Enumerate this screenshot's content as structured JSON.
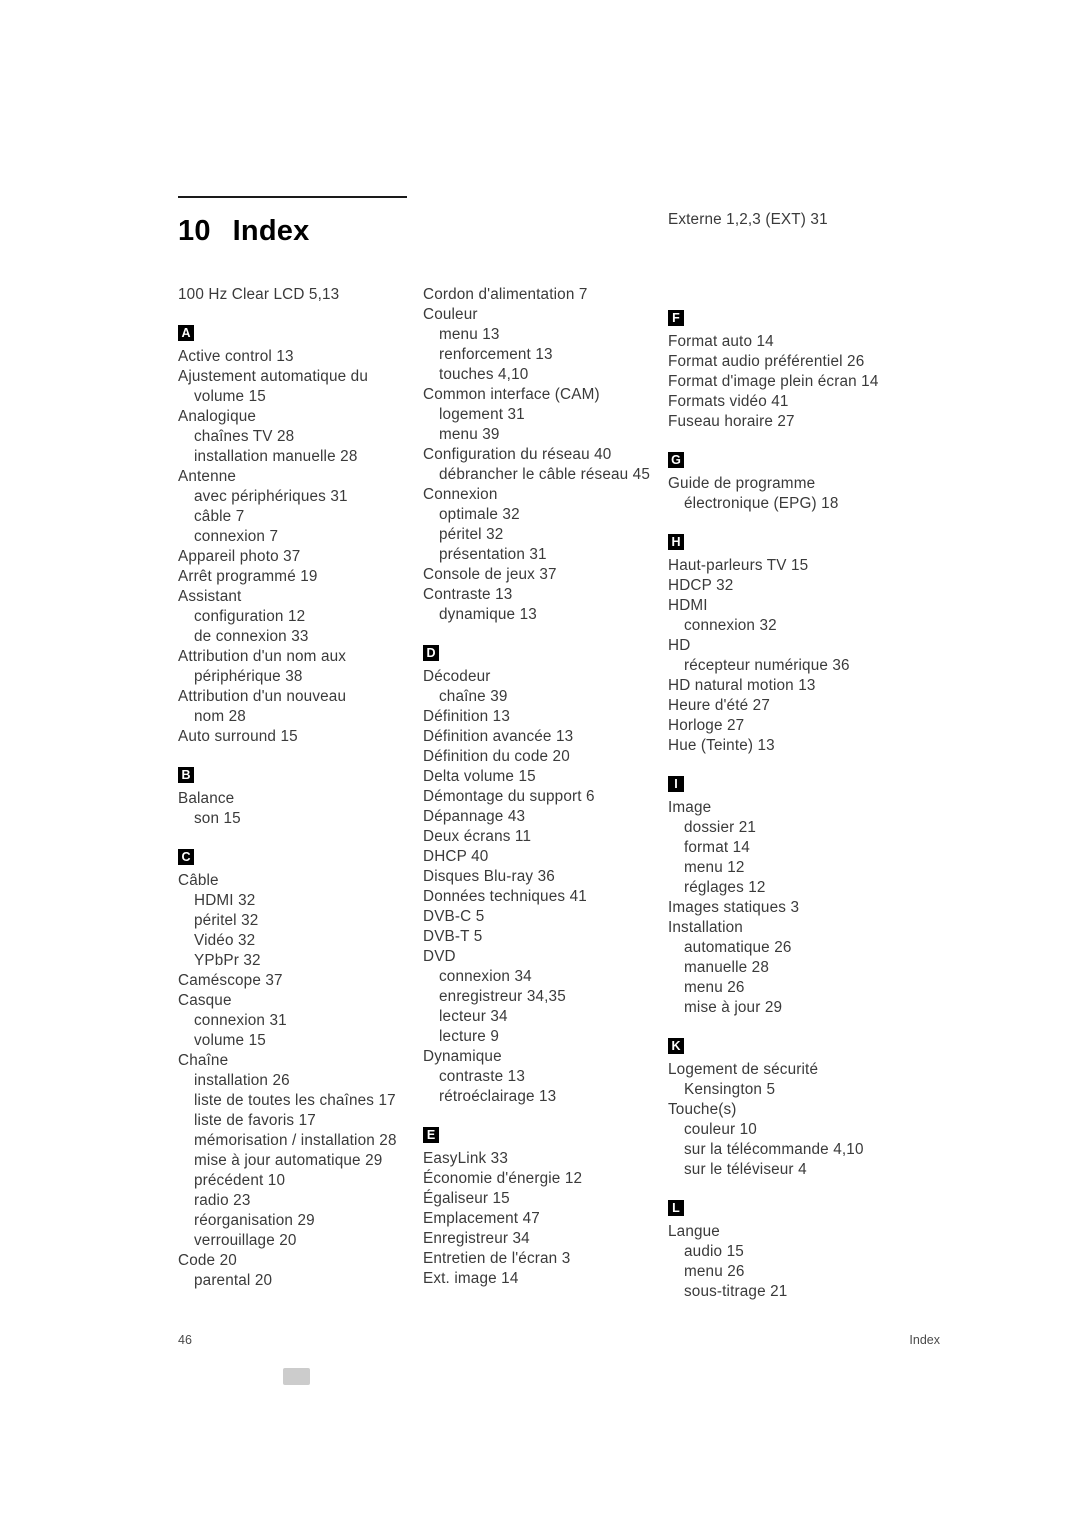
{
  "heading": {
    "number": "10",
    "title": "Index"
  },
  "columns": [
    {
      "id": "column-1",
      "blocks": [
        {
          "type": "entry",
          "level": 0,
          "text": "100 Hz Clear LCD  5,13"
        },
        {
          "type": "letter",
          "letter": "A"
        },
        {
          "type": "entry",
          "level": 0,
          "text": "Active control  13"
        },
        {
          "type": "entry",
          "level": 0,
          "text": "Ajustement automatique du"
        },
        {
          "type": "entry",
          "level": 1,
          "text": "volume  15"
        },
        {
          "type": "entry",
          "level": 0,
          "text": "Analogique"
        },
        {
          "type": "entry",
          "level": 1,
          "text": "chaînes TV  28"
        },
        {
          "type": "entry",
          "level": 1,
          "text": "installation manuelle  28"
        },
        {
          "type": "entry",
          "level": 0,
          "text": "Antenne"
        },
        {
          "type": "entry",
          "level": 1,
          "text": "avec périphériques  31"
        },
        {
          "type": "entry",
          "level": 1,
          "text": "câble  7"
        },
        {
          "type": "entry",
          "level": 1,
          "text": "connexion  7"
        },
        {
          "type": "entry",
          "level": 0,
          "text": "Appareil photo  37"
        },
        {
          "type": "entry",
          "level": 0,
          "text": "Arrêt programmé  19"
        },
        {
          "type": "entry",
          "level": 0,
          "text": "Assistant"
        },
        {
          "type": "entry",
          "level": 1,
          "text": "configuration  12"
        },
        {
          "type": "entry",
          "level": 1,
          "text": "de connexion  33"
        },
        {
          "type": "entry",
          "level": 0,
          "text": "Attribution d'un nom aux"
        },
        {
          "type": "entry",
          "level": 1,
          "text": "périphérique  38"
        },
        {
          "type": "entry",
          "level": 0,
          "text": "Attribution d'un nouveau"
        },
        {
          "type": "entry",
          "level": 1,
          "text": "nom  28"
        },
        {
          "type": "entry",
          "level": 0,
          "text": "Auto surround  15"
        },
        {
          "type": "letter",
          "letter": "B"
        },
        {
          "type": "entry",
          "level": 0,
          "text": "Balance"
        },
        {
          "type": "entry",
          "level": 1,
          "text": "son  15"
        },
        {
          "type": "letter",
          "letter": "C"
        },
        {
          "type": "entry",
          "level": 0,
          "text": "Câble"
        },
        {
          "type": "entry",
          "level": 1,
          "text": "HDMI  32"
        },
        {
          "type": "entry",
          "level": 1,
          "text": "péritel  32"
        },
        {
          "type": "entry",
          "level": 1,
          "text": "Vidéo  32"
        },
        {
          "type": "entry",
          "level": 1,
          "text": "YPbPr  32"
        },
        {
          "type": "entry",
          "level": 0,
          "text": "Caméscope  37"
        },
        {
          "type": "entry",
          "level": 0,
          "text": "Casque"
        },
        {
          "type": "entry",
          "level": 1,
          "text": "connexion  31"
        },
        {
          "type": "entry",
          "level": 1,
          "text": "volume  15"
        },
        {
          "type": "entry",
          "level": 0,
          "text": "Chaîne"
        },
        {
          "type": "entry",
          "level": 1,
          "text": "installation  26"
        },
        {
          "type": "entry",
          "level": 1,
          "text": "liste de toutes les chaînes  17"
        },
        {
          "type": "entry",
          "level": 1,
          "text": "liste de favoris  17"
        },
        {
          "type": "entry",
          "level": 1,
          "text": "mémorisation / installation  28"
        },
        {
          "type": "entry",
          "level": 1,
          "text": "mise à jour automatique  29"
        },
        {
          "type": "entry",
          "level": 1,
          "text": "précédent  10"
        },
        {
          "type": "entry",
          "level": 1,
          "text": "radio  23"
        },
        {
          "type": "entry",
          "level": 1,
          "text": "réorganisation  29"
        },
        {
          "type": "entry",
          "level": 1,
          "text": "verrouillage  20"
        },
        {
          "type": "entry",
          "level": 0,
          "text": "Code  20"
        },
        {
          "type": "entry",
          "level": 1,
          "text": "parental  20"
        }
      ]
    },
    {
      "id": "column-2",
      "blocks": [
        {
          "type": "entry",
          "level": 0,
          "text": "Cordon d'alimentation  7"
        },
        {
          "type": "entry",
          "level": 0,
          "text": "Couleur"
        },
        {
          "type": "entry",
          "level": 1,
          "text": "menu  13"
        },
        {
          "type": "entry",
          "level": 1,
          "text": "renforcement  13"
        },
        {
          "type": "entry",
          "level": 1,
          "text": "touches  4,10"
        },
        {
          "type": "entry",
          "level": 0,
          "text": "Common interface (CAM)"
        },
        {
          "type": "entry",
          "level": 1,
          "text": "logement  31"
        },
        {
          "type": "entry",
          "level": 1,
          "text": "menu  39"
        },
        {
          "type": "entry",
          "level": 0,
          "text": "Configuration du réseau  40"
        },
        {
          "type": "entry",
          "level": 1,
          "text": "débrancher le câble réseau  45"
        },
        {
          "type": "entry",
          "level": 0,
          "text": "Connexion"
        },
        {
          "type": "entry",
          "level": 1,
          "text": "optimale  32"
        },
        {
          "type": "entry",
          "level": 1,
          "text": "péritel  32"
        },
        {
          "type": "entry",
          "level": 1,
          "text": "présentation  31"
        },
        {
          "type": "entry",
          "level": 0,
          "text": "Console de jeux  37"
        },
        {
          "type": "entry",
          "level": 0,
          "text": "Contraste  13"
        },
        {
          "type": "entry",
          "level": 1,
          "text": "dynamique  13"
        },
        {
          "type": "letter",
          "letter": "D"
        },
        {
          "type": "entry",
          "level": 0,
          "text": "Décodeur"
        },
        {
          "type": "entry",
          "level": 1,
          "text": "chaîne  39"
        },
        {
          "type": "entry",
          "level": 0,
          "text": "Définition  13"
        },
        {
          "type": "entry",
          "level": 0,
          "text": "Définition avancée  13"
        },
        {
          "type": "entry",
          "level": 0,
          "text": "Définition du code  20"
        },
        {
          "type": "entry",
          "level": 0,
          "text": "Delta volume  15"
        },
        {
          "type": "entry",
          "level": 0,
          "text": "Démontage du support  6"
        },
        {
          "type": "entry",
          "level": 0,
          "text": "Dépannage  43"
        },
        {
          "type": "entry",
          "level": 0,
          "text": "Deux écrans  11"
        },
        {
          "type": "entry",
          "level": 0,
          "text": "DHCP  40"
        },
        {
          "type": "entry",
          "level": 0,
          "text": "Disques Blu-ray  36"
        },
        {
          "type": "entry",
          "level": 0,
          "text": "Données techniques  41"
        },
        {
          "type": "entry",
          "level": 0,
          "text": "DVB-C  5"
        },
        {
          "type": "entry",
          "level": 0,
          "text": "DVB-T  5"
        },
        {
          "type": "entry",
          "level": 0,
          "text": "DVD"
        },
        {
          "type": "entry",
          "level": 1,
          "text": "connexion  34"
        },
        {
          "type": "entry",
          "level": 1,
          "text": "enregistreur  34,35"
        },
        {
          "type": "entry",
          "level": 1,
          "text": "lecteur  34"
        },
        {
          "type": "entry",
          "level": 1,
          "text": "lecture  9"
        },
        {
          "type": "entry",
          "level": 0,
          "text": "Dynamique"
        },
        {
          "type": "entry",
          "level": 1,
          "text": "contraste  13"
        },
        {
          "type": "entry",
          "level": 1,
          "text": "rétroéclairage  13"
        },
        {
          "type": "letter",
          "letter": "E"
        },
        {
          "type": "entry",
          "level": 0,
          "text": "EasyLink  33"
        },
        {
          "type": "entry",
          "level": 0,
          "text": "Économie d'énergie  12"
        },
        {
          "type": "entry",
          "level": 0,
          "text": "Égaliseur  15"
        },
        {
          "type": "entry",
          "level": 0,
          "text": "Emplacement  47"
        },
        {
          "type": "entry",
          "level": 0,
          "text": "Enregistreur  34"
        },
        {
          "type": "entry",
          "level": 0,
          "text": "Entretien de l'écran  3"
        },
        {
          "type": "entry",
          "level": 0,
          "text": "Ext. image  14"
        }
      ]
    },
    {
      "id": "column-3",
      "blocks": [
        {
          "type": "entry",
          "level": 0,
          "text": "Externe 1,2,3 (EXT)  31"
        },
        {
          "type": "spacer"
        },
        {
          "type": "spacer"
        },
        {
          "type": "spacer"
        },
        {
          "type": "letter",
          "letter": "F"
        },
        {
          "type": "entry",
          "level": 0,
          "text": "Format auto  14"
        },
        {
          "type": "entry",
          "level": 0,
          "text": "Format audio préférentiel  26"
        },
        {
          "type": "entry",
          "level": 0,
          "text": "Format d'image plein écran  14"
        },
        {
          "type": "entry",
          "level": 0,
          "text": "Formats vidéo  41"
        },
        {
          "type": "entry",
          "level": 0,
          "text": "Fuseau horaire  27"
        },
        {
          "type": "letter",
          "letter": "G"
        },
        {
          "type": "entry",
          "level": 0,
          "text": "Guide de programme"
        },
        {
          "type": "entry",
          "level": 1,
          "text": "électronique (EPG)  18"
        },
        {
          "type": "letter",
          "letter": "H"
        },
        {
          "type": "entry",
          "level": 0,
          "text": "Haut-parleurs TV  15"
        },
        {
          "type": "entry",
          "level": 0,
          "text": "HDCP  32"
        },
        {
          "type": "entry",
          "level": 0,
          "text": "HDMI"
        },
        {
          "type": "entry",
          "level": 1,
          "text": "connexion  32"
        },
        {
          "type": "entry",
          "level": 0,
          "text": "HD"
        },
        {
          "type": "entry",
          "level": 1,
          "text": "récepteur numérique  36"
        },
        {
          "type": "entry",
          "level": 0,
          "text": "HD natural motion  13"
        },
        {
          "type": "entry",
          "level": 0,
          "text": "Heure d'été  27"
        },
        {
          "type": "entry",
          "level": 0,
          "text": "Horloge  27"
        },
        {
          "type": "entry",
          "level": 0,
          "text": "Hue (Teinte)  13"
        },
        {
          "type": "letter",
          "letter": "I"
        },
        {
          "type": "entry",
          "level": 0,
          "text": "Image"
        },
        {
          "type": "entry",
          "level": 1,
          "text": "dossier  21"
        },
        {
          "type": "entry",
          "level": 1,
          "text": "format  14"
        },
        {
          "type": "entry",
          "level": 1,
          "text": "menu  12"
        },
        {
          "type": "entry",
          "level": 1,
          "text": "réglages  12"
        },
        {
          "type": "entry",
          "level": 0,
          "text": "Images statiques  3"
        },
        {
          "type": "entry",
          "level": 0,
          "text": "Installation"
        },
        {
          "type": "entry",
          "level": 1,
          "text": "automatique  26"
        },
        {
          "type": "entry",
          "level": 1,
          "text": "manuelle  28"
        },
        {
          "type": "entry",
          "level": 1,
          "text": "menu  26"
        },
        {
          "type": "entry",
          "level": 1,
          "text": "mise à jour  29"
        },
        {
          "type": "letter",
          "letter": "K"
        },
        {
          "type": "entry",
          "level": 0,
          "text": "Logement de sécurité"
        },
        {
          "type": "entry",
          "level": 1,
          "text": "Kensington 5"
        },
        {
          "type": "entry",
          "level": 0,
          "text": "Touche(s)"
        },
        {
          "type": "entry",
          "level": 1,
          "text": "couleur  10"
        },
        {
          "type": "entry",
          "level": 1,
          "text": "sur la télécommande  4,10"
        },
        {
          "type": "entry",
          "level": 1,
          "text": "sur le téléviseur  4"
        },
        {
          "type": "letter",
          "letter": "L"
        },
        {
          "type": "entry",
          "level": 0,
          "text": "Langue"
        },
        {
          "type": "entry",
          "level": 1,
          "text": "audio  15"
        },
        {
          "type": "entry",
          "level": 1,
          "text": "menu  26"
        },
        {
          "type": "entry",
          "level": 1,
          "text": "sous-titrage  21"
        }
      ]
    }
  ],
  "footer": {
    "page_number": "46",
    "section_label": "Index"
  }
}
